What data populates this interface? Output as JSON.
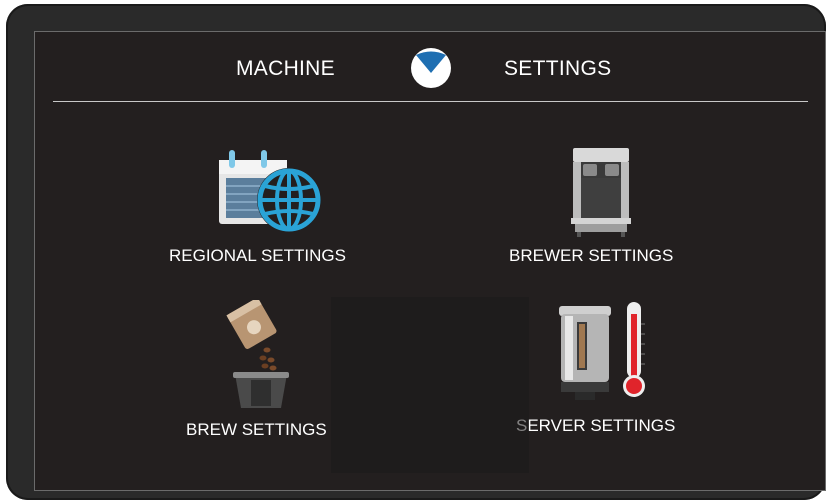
{
  "header": {
    "left_label": "MACHINE",
    "right_label": "SETTINGS",
    "logo_icon": "checkmark-shield-icon",
    "accent_color": "#1f6fb2"
  },
  "tiles": [
    {
      "label": "REGIONAL SETTINGS",
      "icon": "calendar-globe-icon"
    },
    {
      "label": "BREWER SETTINGS",
      "icon": "coffee-brewer-icon"
    },
    {
      "label": "BREW SETTINGS",
      "icon": "coffee-filter-basket-icon"
    },
    {
      "label": "SERVER SETTINGS",
      "icon": "server-thermometer-icon"
    }
  ],
  "colors": {
    "screen_bg": "#231f1f",
    "bezel": "#2a2a2a",
    "text": "#ffffff",
    "globe": "#2aa3d6",
    "thermometer": "#e0242b"
  }
}
